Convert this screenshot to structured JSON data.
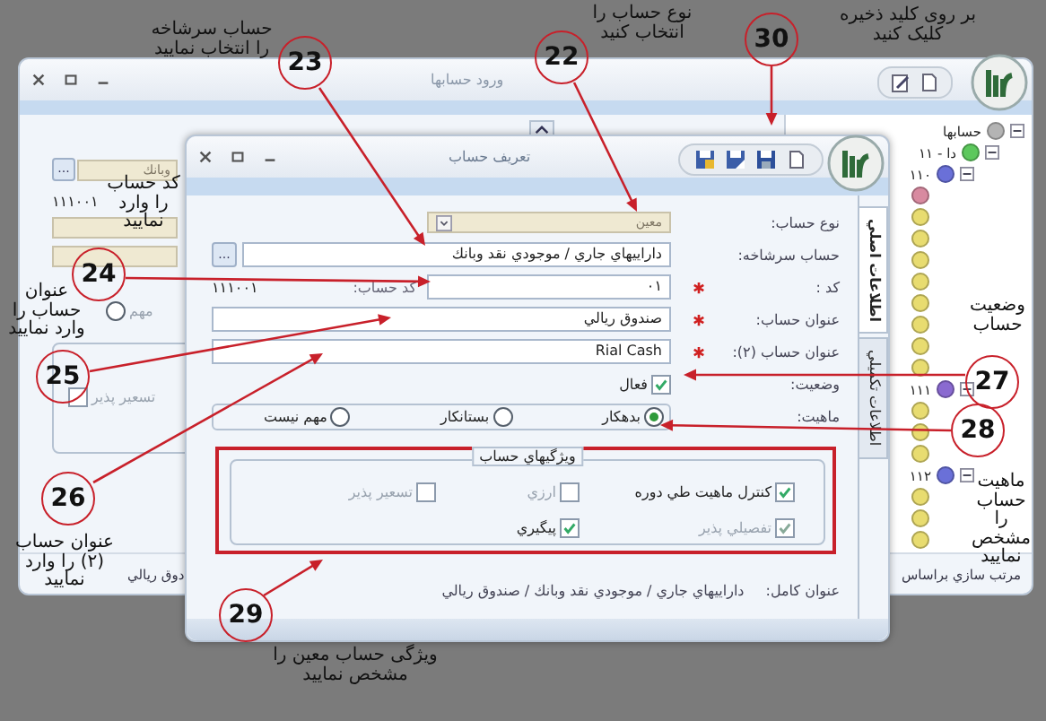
{
  "back_window": {
    "title": "ورود حسابها",
    "lookup_button": "...",
    "lookup_value": "وبانك",
    "code": "۱۱۱۰۰۱",
    "radio": {
      "label": "مهم",
      "selected": false
    },
    "checkbox": {
      "label": "تسعير پذير",
      "checked": false,
      "disabled": true
    },
    "footer_left": "دوق ريالي",
    "footer_right": "مرتب سازي براساس",
    "tree": [
      {
        "label": "حسابها",
        "color": "#b4b4b4",
        "expanded": true,
        "children": [
          {
            "label": "۱۱ - دا",
            "color": "#5cc85c",
            "expanded": true,
            "children": [
              {
                "label": "۱۱۰",
                "color": "#6a70d8",
                "expanded": true,
                "children": [
                  {
                    "color": "#d88aa0"
                  },
                  {
                    "color": "#e8dc70"
                  },
                  {
                    "color": "#e8dc70"
                  },
                  {
                    "color": "#e8dc70"
                  },
                  {
                    "color": "#e8dc70"
                  },
                  {
                    "color": "#e8dc70"
                  },
                  {
                    "color": "#e8dc70"
                  },
                  {
                    "color": "#e8dc70"
                  },
                  {
                    "color": "#e8dc70"
                  }
                ]
              },
              {
                "label": "۱۱۱",
                "color": "#8a6ad0",
                "expanded": true,
                "children": [
                  {
                    "color": "#e8dc70"
                  },
                  {
                    "color": "#e8dc70"
                  },
                  {
                    "color": "#e8dc70"
                  }
                ]
              },
              {
                "label": "۱۱۲",
                "color": "#6a70d8",
                "expanded": true,
                "children": [
                  {
                    "color": "#e8dc70"
                  },
                  {
                    "color": "#e8dc70"
                  },
                  {
                    "color": "#e8dc70"
                  }
                ]
              }
            ]
          }
        ]
      }
    ]
  },
  "dialog": {
    "title": "تعريف حساب",
    "fields": [
      {
        "kind": "combo",
        "label": "نوع حساب:",
        "value": "معين",
        "required": false,
        "disabled": true
      },
      {
        "kind": "lookup",
        "label": "حساب سرشاخه:",
        "value": "دارايیهاي جاري / موجودي نقد وبانك",
        "button": "...",
        "required": false
      },
      {
        "kind": "code",
        "label": "کد :",
        "value": "۰۱",
        "required": true,
        "code_label": "کد حساب:",
        "code_prefix": "۱۱۱۰۰۱"
      },
      {
        "kind": "text",
        "label": "عنوان حساب:",
        "value": "صندوق ريالي",
        "required": true
      },
      {
        "kind": "text",
        "label": "عنوان حساب (۲):",
        "value": "Rial Cash",
        "required": true
      },
      {
        "kind": "checkbox",
        "label": "وضعيت:",
        "option": "فعال",
        "checked": true
      },
      {
        "kind": "radio",
        "label": "ماهيت:",
        "options": [
          {
            "label": "بدهكار",
            "selected": true
          },
          {
            "label": "بستانكار",
            "selected": false
          },
          {
            "label": "مهم نيست",
            "selected": false
          }
        ]
      }
    ],
    "group": {
      "title": "ويژگیهاي حساب",
      "options": [
        {
          "label": "كنترل ماهيت طي دوره",
          "checked": true,
          "disabled": false
        },
        {
          "label": "ارزي",
          "checked": false,
          "disabled": true
        },
        {
          "label": "تسعير پذير",
          "checked": false,
          "disabled": true
        },
        {
          "label": "تفصيلي پذير",
          "checked": true,
          "disabled": true
        },
        {
          "label": "پيگيري",
          "checked": true,
          "disabled": false
        }
      ]
    },
    "full_title": {
      "label": "عنوان كامل:",
      "value": "دارايیهاي جاري / موجودي نقد وبانك / صندوق ريالي"
    },
    "tabs": [
      {
        "label": "اطلاعات اصلي",
        "selected": true
      },
      {
        "label": "اطلاعات تكميلي",
        "selected": false
      }
    ]
  },
  "annotations": [
    {
      "number": "22",
      "caption": "نوع حساب را انتخاب کنید"
    },
    {
      "number": "23",
      "caption": "حساب سرشاخه را انتخاب نمایید"
    },
    {
      "number": "24",
      "caption": "کد حساب را وارد نمایید"
    },
    {
      "number": "25",
      "caption": "عنوان حساب را وارد نمایید"
    },
    {
      "number": "26",
      "caption": "عنوان حساب (۲) را وارد نمایید"
    },
    {
      "number": "27",
      "caption": "وضعيت حساب"
    },
    {
      "number": "28",
      "caption": "ماهيت حساب را مشخص نمایید"
    },
    {
      "number": "29",
      "caption": "ویژگی حساب معین را مشخص نمایید"
    },
    {
      "number": "30",
      "caption": "بر روی کلید ذخیره کلیک کنید"
    }
  ]
}
